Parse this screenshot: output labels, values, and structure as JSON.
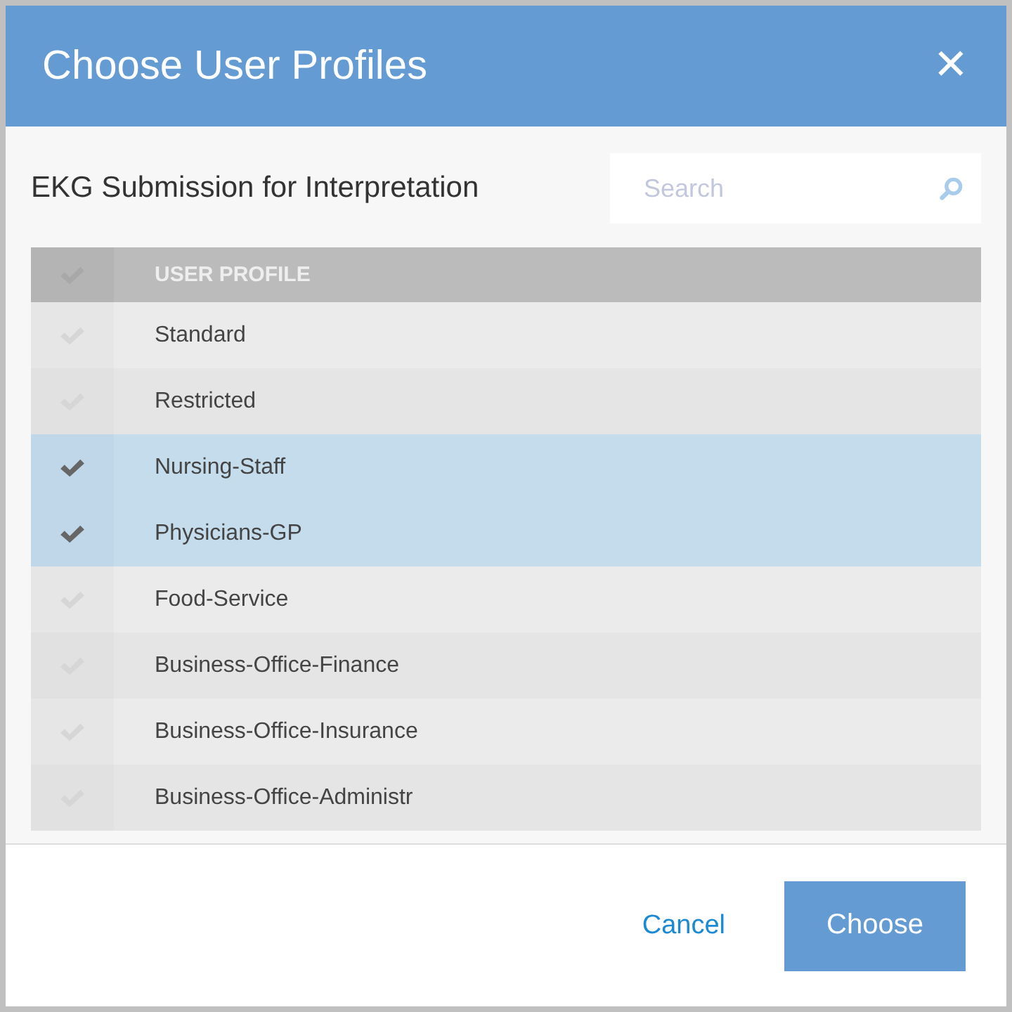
{
  "dialog": {
    "title": "Choose User Profiles",
    "close": "✕"
  },
  "subtitle": "EKG Submission for Interpretation",
  "search": {
    "placeholder": "Search"
  },
  "table": {
    "all_selected": false,
    "columns": [
      "USER PROFILE"
    ],
    "rows": [
      {
        "name": "Standard",
        "selected": false
      },
      {
        "name": "Restricted",
        "selected": false
      },
      {
        "name": "Nursing-Staff",
        "selected": true
      },
      {
        "name": "Physicians-GP",
        "selected": true
      },
      {
        "name": "Food-Service",
        "selected": false
      },
      {
        "name": "Business-Office-Finance",
        "selected": false
      },
      {
        "name": "Business-Office-Insurance",
        "selected": false
      },
      {
        "name": "Business-Office-Administr",
        "selected": false
      }
    ]
  },
  "buttons": {
    "cancel": "Cancel",
    "confirm": "Choose"
  }
}
